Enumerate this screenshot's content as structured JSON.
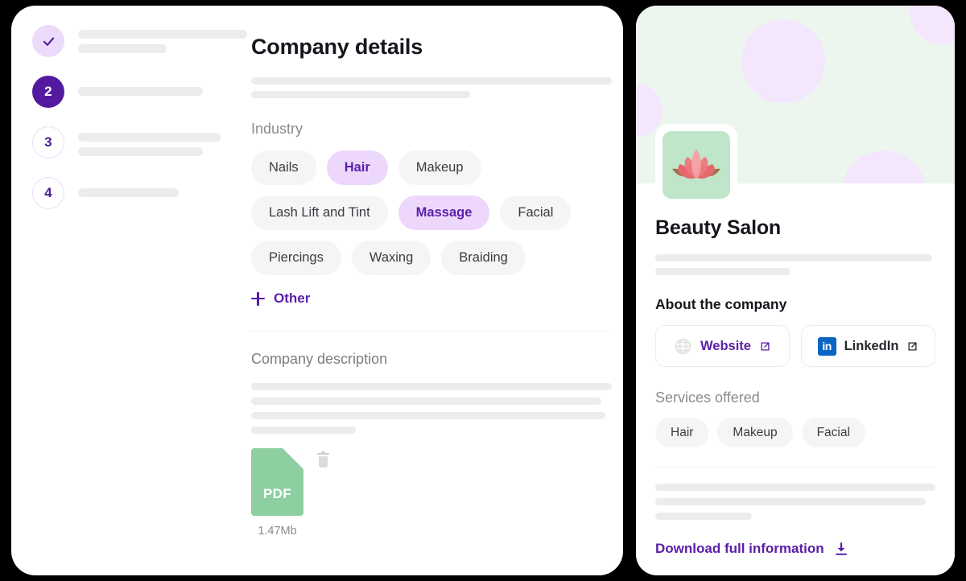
{
  "theme": {
    "accent_purple": "#5b1ea8",
    "accent_purple_solid": "#531aa0",
    "chip_selected_bg": "#edd8fc",
    "chip_bg": "#f5f5f6",
    "banner_green": "#ecf6ee",
    "banner_blob": "#f3e6fd",
    "logo_tile_green": "#bfe6c8",
    "pdf_green": "#8dcfa0",
    "linkedin_blue": "#0a66c2",
    "skeleton_gray": "#ececec",
    "page_background": "#000000"
  },
  "left_panel": {
    "stepper": {
      "steps": [
        {
          "label": "1",
          "state": "done",
          "icon": "check-icon",
          "lines": [
            210,
            110
          ]
        },
        {
          "label": "2",
          "state": "active",
          "icon": "",
          "lines": [
            155
          ]
        },
        {
          "label": "3",
          "state": "todo",
          "icon": "",
          "lines": [
            177,
            155
          ]
        },
        {
          "label": "4",
          "state": "todo",
          "icon": "",
          "lines": [
            125
          ]
        }
      ]
    },
    "title": "Company details",
    "title_skeleton": [
      448,
      272
    ],
    "industry": {
      "label": "Industry",
      "chips": [
        {
          "label": "Nails",
          "selected": false
        },
        {
          "label": "Hair",
          "selected": true
        },
        {
          "label": "Makeup",
          "selected": false
        },
        {
          "label": "Lash Lift and Tint",
          "selected": false
        },
        {
          "label": "Massage",
          "selected": true
        },
        {
          "label": "Facial",
          "selected": false
        },
        {
          "label": "Piercings",
          "selected": false
        },
        {
          "label": "Waxing",
          "selected": false
        },
        {
          "label": "Braiding",
          "selected": false
        }
      ],
      "other_label": "Other"
    },
    "description": {
      "label": "Company description",
      "skeleton": [
        448,
        435,
        440,
        130
      ]
    },
    "file": {
      "type_label": "PDF",
      "size": "1.47Mb"
    }
  },
  "right_panel": {
    "logo_alt": "lotus-flower-logo",
    "company_name": "Beauty Salon",
    "name_skeleton": [
      344,
      168
    ],
    "about_title": "About the company",
    "links": [
      {
        "label": "Website",
        "icon": "globe-icon",
        "style": "purple"
      },
      {
        "label": "LinkedIn",
        "icon": "linkedin-icon",
        "style": "dark"
      }
    ],
    "services": {
      "label": "Services offered",
      "chips": [
        "Hair",
        "Makeup",
        "Facial"
      ]
    },
    "footer_skeleton": [
      348,
      336,
      120
    ],
    "download_label": "Download full information"
  }
}
